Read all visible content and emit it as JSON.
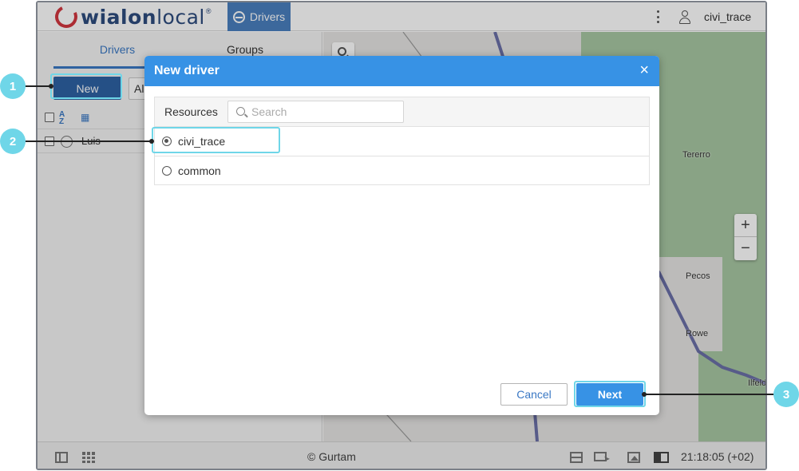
{
  "header": {
    "logo_text": "wialon",
    "logo_text_2": "local",
    "logo_sup": "®",
    "nav_active_label": "Drivers",
    "username": "civi_trace"
  },
  "left_panel": {
    "tabs": [
      {
        "label": "Drivers",
        "active": true
      },
      {
        "label": "Groups",
        "active": false
      }
    ],
    "new_button": "New",
    "filter_value": "All",
    "drivers": [
      {
        "name": "Luis"
      }
    ]
  },
  "map": {
    "labels": [
      "Tererro",
      "Pecos",
      "Rowe",
      "Ilfeld"
    ],
    "zoom_in": "+",
    "zoom_out": "−"
  },
  "footer": {
    "copyright": "© Gurtam",
    "clock": "21:18:05 (+02)"
  },
  "dialog": {
    "title": "New driver",
    "close": "×",
    "resources_label": "Resources",
    "search_placeholder": "Search",
    "resources": [
      {
        "name": "civi_trace",
        "selected": true
      },
      {
        "name": "common",
        "selected": false
      }
    ],
    "cancel_label": "Cancel",
    "next_label": "Next"
  },
  "callouts": [
    "1",
    "2",
    "3"
  ],
  "colors": {
    "accent": "#3792e5",
    "nav_active": "#4a7fbf",
    "new_button": "#2e62a4",
    "callout": "#6fd6e8",
    "map_green": "#a8c7a3"
  }
}
